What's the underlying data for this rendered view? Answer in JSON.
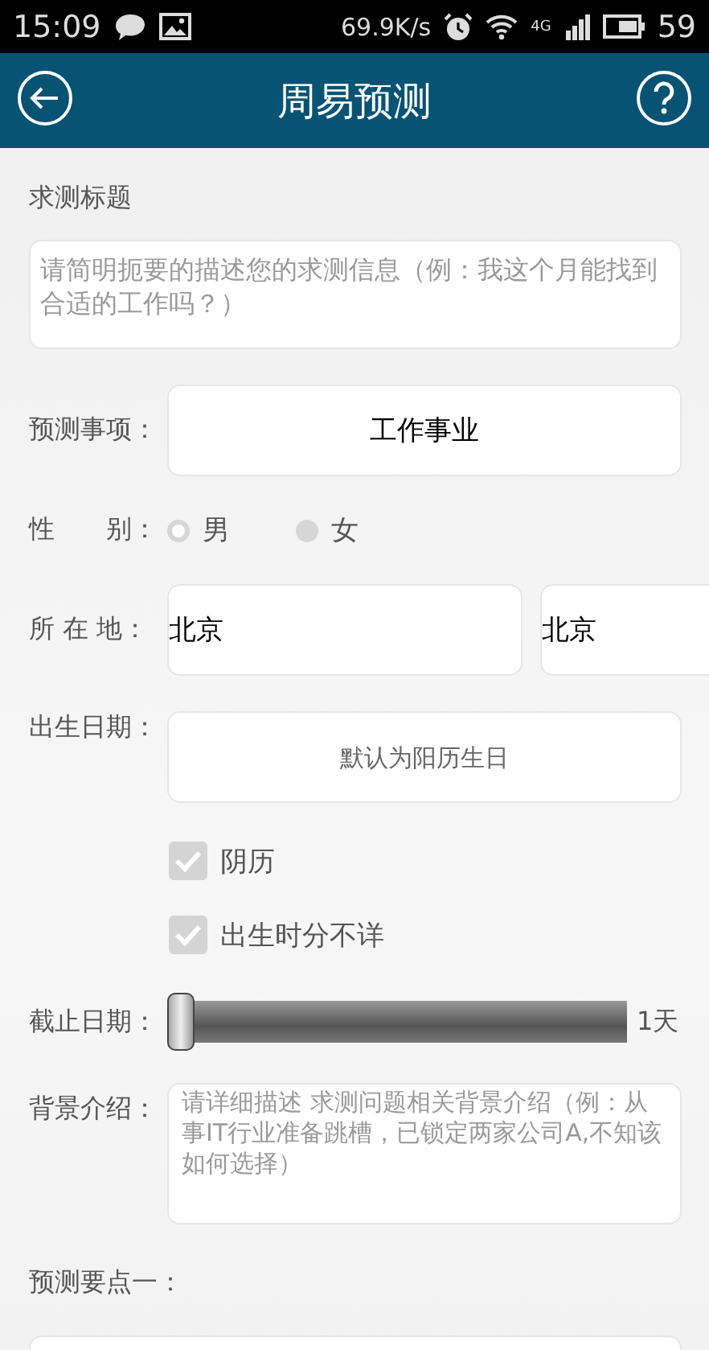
{
  "status_bar": {
    "time": "15:09",
    "net_speed": "69.9K/s",
    "network": "4G",
    "battery": "59"
  },
  "header": {
    "title": "周易预测"
  },
  "form": {
    "title_label": "求测标题",
    "title_field": {
      "placeholder": "请简明扼要的描述您的求测信息（例：我这个月能找到合适的工作吗？）"
    },
    "rows": [
      {
        "kind": "select",
        "label": "预测事项：",
        "value": "工作事业"
      },
      {
        "kind": "radio",
        "label": "性　　别：",
        "options": [
          {
            "label": "男",
            "selected": false
          },
          {
            "label": "女",
            "selected": true
          }
        ]
      },
      {
        "kind": "location",
        "label": "所 在 地：",
        "fields": [
          {
            "value": "北京"
          },
          {
            "value": "北京"
          }
        ]
      },
      {
        "kind": "date",
        "label": "出生日期：",
        "placeholder": "默认为阳历生日"
      },
      {
        "kind": "checkbox",
        "label": "阴历",
        "checked": true
      },
      {
        "kind": "checkbox",
        "label": "出生时分不详",
        "checked": true
      },
      {
        "kind": "slider",
        "label": "截止日期：",
        "level": 0,
        "reading": "1天"
      },
      {
        "kind": "textarea",
        "label": "背景介绍：",
        "placeholder": "请详细描述 求测问题相关背景介绍（例：从事IT行业准备跳槽，已锁定两家公司A,不知该如何选择）"
      },
      {
        "kind": "heading",
        "label": "预测要点一："
      }
    ]
  }
}
